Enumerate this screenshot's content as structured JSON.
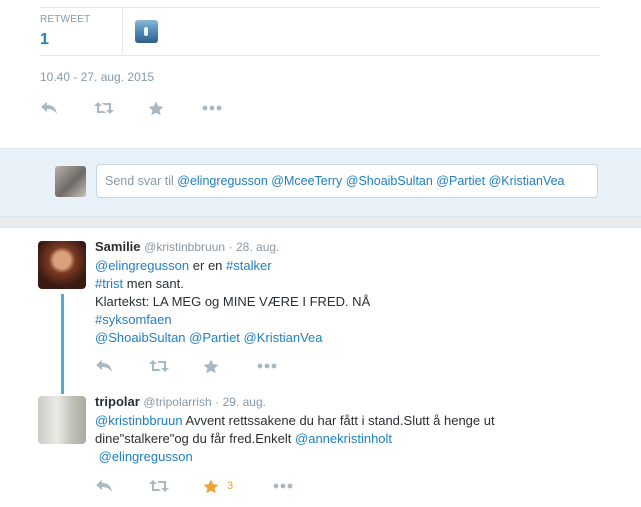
{
  "stats": {
    "retweet_label": "RETWEET",
    "retweet_value": "1"
  },
  "tweet_time": "10.40 - 27. aug. 2015",
  "reply": {
    "prefix": "Send svar til",
    "mentions": "@elingregusson @MceeTerry @ShoaibSultan @Partiet @KristianVea"
  },
  "tweets": [
    {
      "name": "Samilie",
      "handle": "@kristinbbruun",
      "date": "· 28. aug.",
      "l1_mention": "@elingregusson",
      "l1_text": " er en ",
      "l1_tag": "#stalker",
      "l2_tag": "#trist",
      "l2_text": " men sant.",
      "l3_text": "Klartekst: LA MEG og MINE VÆRE I FRED. NÅ",
      "l4_tag": "#syksomfaen",
      "l5_mentions": "@ShoaibSultan @Partiet @KristianVea"
    },
    {
      "name": "tripolar",
      "handle": "@tripolarrish",
      "date": "· 29. aug.",
      "l1_mention": "@kristinbbruun",
      "l1_text": " Avvent rettssakene du har fått i stand.Slutt å henge ut",
      "l2_text": "dine\"stalkere\"og du får fred.Enkelt ",
      "l2_mention": "@annekristinholt",
      "l3_mention": "@elingregusson",
      "fav_count": "3"
    }
  ],
  "colors": {
    "accent": "#1f7fbf",
    "favorite": "#f0a23b",
    "thread": "#52aad8"
  }
}
